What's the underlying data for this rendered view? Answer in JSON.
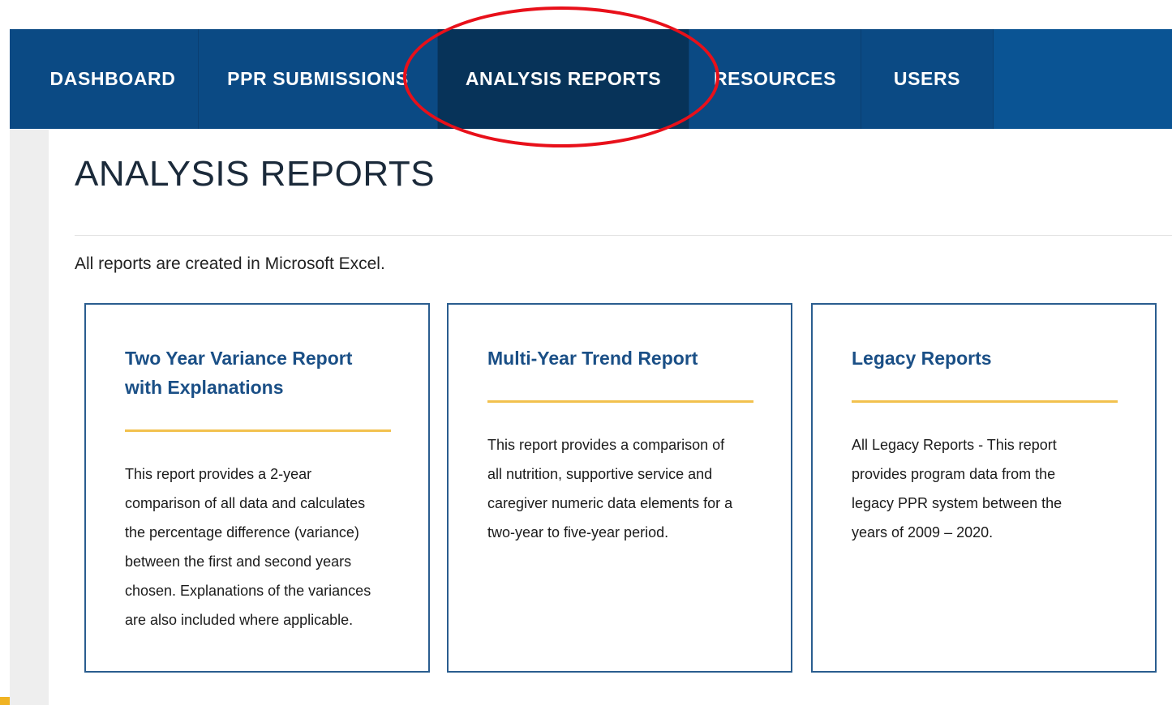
{
  "nav": {
    "items": [
      {
        "label": "DASHBOARD",
        "active": false
      },
      {
        "label": "PPR SUBMISSIONS",
        "active": false
      },
      {
        "label": "ANALYSIS REPORTS",
        "active": true
      },
      {
        "label": "RESOURCES",
        "active": false
      },
      {
        "label": "USERS",
        "active": false
      }
    ]
  },
  "page": {
    "title": "ANALYSIS REPORTS",
    "intro": "All reports are created in Microsoft Excel."
  },
  "cards": [
    {
      "title_lines": [
        "Two Year Variance Report",
        "with Explanations"
      ],
      "description_lines": [
        "This report provides a 2-year",
        "comparison of all data and calculates",
        "the percentage difference (variance)",
        "between the first and second years",
        "chosen. Explanations of the variances",
        "are also included where applicable."
      ]
    },
    {
      "title_lines": [
        "Multi-Year Trend Report"
      ],
      "description_lines": [
        "This report provides a comparison of",
        "all nutrition, supportive service and",
        "caregiver numeric data elements for a",
        "two-year to five-year period."
      ]
    },
    {
      "title_lines": [
        "Legacy Reports"
      ],
      "description_lines": [
        "All Legacy Reports - This report",
        "provides program data from the",
        "legacy PPR system between the",
        "years of 2009 – 2020."
      ]
    }
  ],
  "colors": {
    "nav_bg": "#0b4a84",
    "nav_active": "#073359",
    "card_title": "#1a4f86",
    "card_rule": "#f2c14e",
    "highlight": "#e8101a"
  }
}
